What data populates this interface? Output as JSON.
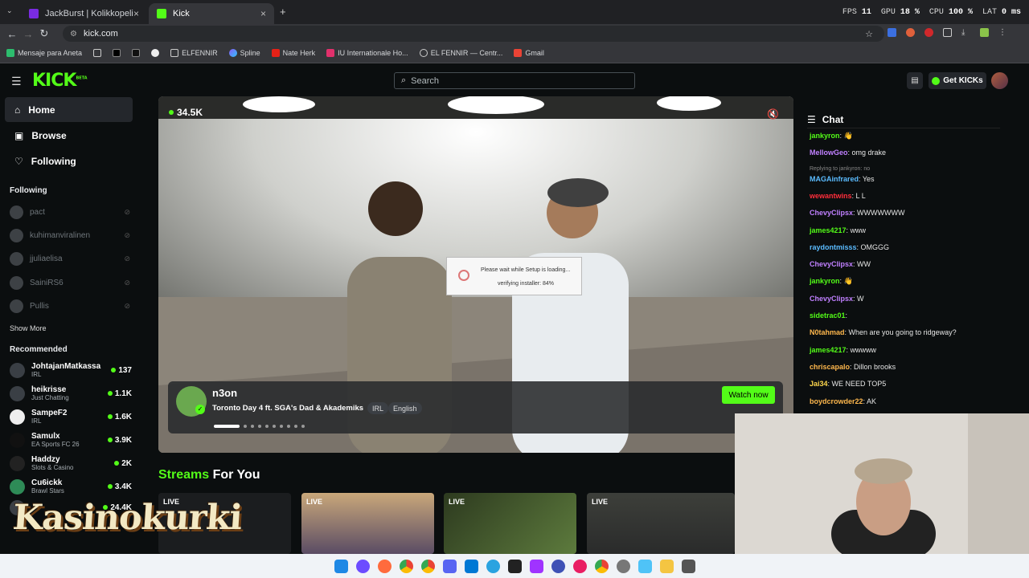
{
  "browser": {
    "tabs": [
      {
        "label": "JackBurst | Kolikkopelit ja jackp",
        "active": false
      },
      {
        "label": "Kick",
        "active": true
      }
    ],
    "new_tab": "+",
    "url": "kick.com",
    "bookmarks": [
      "Mensaje para Aneta",
      "ELFENNIR",
      "Spline",
      "Nate Herk",
      "IU Internationale Ho...",
      "EL FENNIR — Centr...",
      "Gmail"
    ]
  },
  "hud": {
    "fps_label": "FPS",
    "fps": "11",
    "gpu_label": "GPU",
    "gpu": "18 %",
    "cpu_label": "CPU",
    "cpu": "100 %",
    "lat_label": "LAT",
    "lat": "0 ms"
  },
  "header": {
    "logo": "KICK",
    "beta": "BETA",
    "search_placeholder": "Search",
    "get_kicks": "Get KICKs"
  },
  "sidebar": {
    "nav": [
      {
        "label": "Home",
        "icon": "home-icon"
      },
      {
        "label": "Browse",
        "icon": "browse-icon"
      },
      {
        "label": "Following",
        "icon": "heart-icon"
      }
    ],
    "following_title": "Following",
    "following": [
      "pact",
      "kuhimanviralinen",
      "jjuliaelisa",
      "SainiRS6",
      "Pullis"
    ],
    "show_more": "Show More",
    "recommended_title": "Recommended",
    "recommended": [
      {
        "name": "JohtajanMatkassa",
        "cat": "IRL",
        "viewers": "137"
      },
      {
        "name": "heikrisse",
        "cat": "Just Chatting",
        "viewers": "1.1K"
      },
      {
        "name": "SampeF2",
        "cat": "IRL",
        "viewers": "1.6K"
      },
      {
        "name": "Samulx",
        "cat": "EA Sports FC 26",
        "viewers": "3.9K"
      },
      {
        "name": "Haddzy",
        "cat": "Slots & Casino",
        "viewers": "2K"
      },
      {
        "name": "Cu6ickk",
        "cat": "Brawl Stars",
        "viewers": "3.4K"
      },
      {
        "name": "",
        "cat": "",
        "viewers": "24.4K"
      }
    ]
  },
  "player": {
    "viewers": "34.5K",
    "streamer": "n3on",
    "title": "Toronto Day 4 ft. SGA's Dad & Akademiks",
    "tags": [
      "IRL",
      "English"
    ],
    "watch_now": "Watch now",
    "carousel_count": 10,
    "popup_line1": "Please wait while Setup is loading...",
    "popup_line2": "verifying installer: 84%"
  },
  "streams": {
    "heading_accent": "Streams",
    "heading_rest": "For You",
    "live_label": "LIVE"
  },
  "chat": {
    "title": "Chat",
    "messages": [
      {
        "user": "jankyron",
        "color": "#53fc18",
        "text": " 👋"
      },
      {
        "user": "MellowGeo",
        "color": "#c080ff",
        "text": "omg drake"
      },
      {
        "reply": "Replying to jankyron: no",
        "user": "MAGAinfrared",
        "color": "#5bbcff",
        "text": "Yes"
      },
      {
        "user": "wewantwins",
        "color": "#ff2e3b",
        "text": " L L"
      },
      {
        "user": "ChevyClipsx",
        "color": "#c080ff",
        "text": "WWWWWWW"
      },
      {
        "user": "james4217",
        "color": "#53fc18",
        "text": "www"
      },
      {
        "user": "raydontmisss",
        "color": "#5bbcff",
        "text": "OMGGG"
      },
      {
        "user": "ChevyClipsx",
        "color": "#c080ff",
        "text": "WW"
      },
      {
        "user": "jankyron",
        "color": "#53fc18",
        "text": " 👋"
      },
      {
        "user": "ChevyClipsx",
        "color": "#c080ff",
        "text": "W"
      },
      {
        "user": "sidetrac01",
        "color": "#53fc18",
        "text": ""
      },
      {
        "user": "N0tahmad",
        "color": "#ffb84d",
        "text": "When are you going to ridgeway?"
      },
      {
        "user": "james4217",
        "color": "#53fc18",
        "text": "wwwww"
      },
      {
        "user": "chriscapalo",
        "color": "#ffb84d",
        "text": "Dillon brooks"
      },
      {
        "user": "Jai34",
        "color": "#ffd84d",
        "text": "WE NEED TOP5"
      },
      {
        "user": "boydcrowder22",
        "color": "#ffb84d",
        "text": "AK"
      }
    ]
  },
  "overlay": {
    "brand": "Kasinokurki"
  },
  "colors": {
    "kick_green": "#53fc18",
    "bg": "#0b0e0f"
  }
}
